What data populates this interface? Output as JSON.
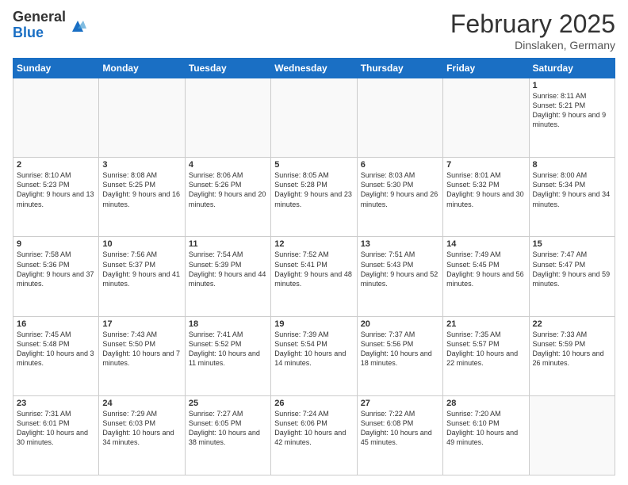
{
  "logo": {
    "general": "General",
    "blue": "Blue"
  },
  "header": {
    "month": "February 2025",
    "location": "Dinslaken, Germany"
  },
  "weekdays": [
    "Sunday",
    "Monday",
    "Tuesday",
    "Wednesday",
    "Thursday",
    "Friday",
    "Saturday"
  ],
  "weeks": [
    [
      {
        "day": "",
        "info": ""
      },
      {
        "day": "",
        "info": ""
      },
      {
        "day": "",
        "info": ""
      },
      {
        "day": "",
        "info": ""
      },
      {
        "day": "",
        "info": ""
      },
      {
        "day": "",
        "info": ""
      },
      {
        "day": "1",
        "info": "Sunrise: 8:11 AM\nSunset: 5:21 PM\nDaylight: 9 hours and 9 minutes."
      }
    ],
    [
      {
        "day": "2",
        "info": "Sunrise: 8:10 AM\nSunset: 5:23 PM\nDaylight: 9 hours and 13 minutes."
      },
      {
        "day": "3",
        "info": "Sunrise: 8:08 AM\nSunset: 5:25 PM\nDaylight: 9 hours and 16 minutes."
      },
      {
        "day": "4",
        "info": "Sunrise: 8:06 AM\nSunset: 5:26 PM\nDaylight: 9 hours and 20 minutes."
      },
      {
        "day": "5",
        "info": "Sunrise: 8:05 AM\nSunset: 5:28 PM\nDaylight: 9 hours and 23 minutes."
      },
      {
        "day": "6",
        "info": "Sunrise: 8:03 AM\nSunset: 5:30 PM\nDaylight: 9 hours and 26 minutes."
      },
      {
        "day": "7",
        "info": "Sunrise: 8:01 AM\nSunset: 5:32 PM\nDaylight: 9 hours and 30 minutes."
      },
      {
        "day": "8",
        "info": "Sunrise: 8:00 AM\nSunset: 5:34 PM\nDaylight: 9 hours and 34 minutes."
      }
    ],
    [
      {
        "day": "9",
        "info": "Sunrise: 7:58 AM\nSunset: 5:36 PM\nDaylight: 9 hours and 37 minutes."
      },
      {
        "day": "10",
        "info": "Sunrise: 7:56 AM\nSunset: 5:37 PM\nDaylight: 9 hours and 41 minutes."
      },
      {
        "day": "11",
        "info": "Sunrise: 7:54 AM\nSunset: 5:39 PM\nDaylight: 9 hours and 44 minutes."
      },
      {
        "day": "12",
        "info": "Sunrise: 7:52 AM\nSunset: 5:41 PM\nDaylight: 9 hours and 48 minutes."
      },
      {
        "day": "13",
        "info": "Sunrise: 7:51 AM\nSunset: 5:43 PM\nDaylight: 9 hours and 52 minutes."
      },
      {
        "day": "14",
        "info": "Sunrise: 7:49 AM\nSunset: 5:45 PM\nDaylight: 9 hours and 56 minutes."
      },
      {
        "day": "15",
        "info": "Sunrise: 7:47 AM\nSunset: 5:47 PM\nDaylight: 9 hours and 59 minutes."
      }
    ],
    [
      {
        "day": "16",
        "info": "Sunrise: 7:45 AM\nSunset: 5:48 PM\nDaylight: 10 hours and 3 minutes."
      },
      {
        "day": "17",
        "info": "Sunrise: 7:43 AM\nSunset: 5:50 PM\nDaylight: 10 hours and 7 minutes."
      },
      {
        "day": "18",
        "info": "Sunrise: 7:41 AM\nSunset: 5:52 PM\nDaylight: 10 hours and 11 minutes."
      },
      {
        "day": "19",
        "info": "Sunrise: 7:39 AM\nSunset: 5:54 PM\nDaylight: 10 hours and 14 minutes."
      },
      {
        "day": "20",
        "info": "Sunrise: 7:37 AM\nSunset: 5:56 PM\nDaylight: 10 hours and 18 minutes."
      },
      {
        "day": "21",
        "info": "Sunrise: 7:35 AM\nSunset: 5:57 PM\nDaylight: 10 hours and 22 minutes."
      },
      {
        "day": "22",
        "info": "Sunrise: 7:33 AM\nSunset: 5:59 PM\nDaylight: 10 hours and 26 minutes."
      }
    ],
    [
      {
        "day": "23",
        "info": "Sunrise: 7:31 AM\nSunset: 6:01 PM\nDaylight: 10 hours and 30 minutes."
      },
      {
        "day": "24",
        "info": "Sunrise: 7:29 AM\nSunset: 6:03 PM\nDaylight: 10 hours and 34 minutes."
      },
      {
        "day": "25",
        "info": "Sunrise: 7:27 AM\nSunset: 6:05 PM\nDaylight: 10 hours and 38 minutes."
      },
      {
        "day": "26",
        "info": "Sunrise: 7:24 AM\nSunset: 6:06 PM\nDaylight: 10 hours and 42 minutes."
      },
      {
        "day": "27",
        "info": "Sunrise: 7:22 AM\nSunset: 6:08 PM\nDaylight: 10 hours and 45 minutes."
      },
      {
        "day": "28",
        "info": "Sunrise: 7:20 AM\nSunset: 6:10 PM\nDaylight: 10 hours and 49 minutes."
      },
      {
        "day": "",
        "info": ""
      }
    ]
  ]
}
